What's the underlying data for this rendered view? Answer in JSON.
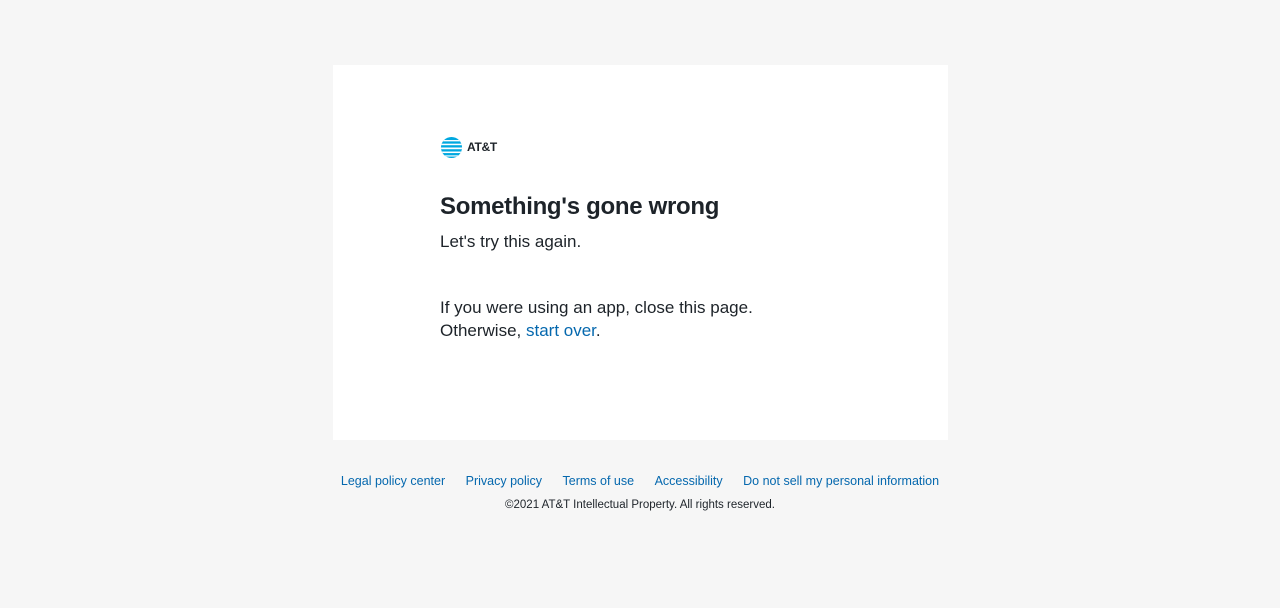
{
  "brand": {
    "logo_text": "AT&T",
    "logo_icon": "att-globe-icon",
    "logo_color": "#00a8e0"
  },
  "error": {
    "title": "Something's gone wrong",
    "subtitle": "Let's try this again.",
    "line1": "If you were using an app, close this page.",
    "line2_prefix": "Otherwise, ",
    "link_text": "start over",
    "line2_suffix": "."
  },
  "footer": {
    "links": {
      "legal": "Legal policy center",
      "privacy": "Privacy policy",
      "terms": "Terms of use",
      "accessibility": "Accessibility",
      "do_not_sell": "Do not sell my personal information"
    },
    "copyright": "©2021 AT&T Intellectual Property. All rights reserved."
  },
  "colors": {
    "background": "#f6f6f6",
    "card": "#ffffff",
    "text": "#1d2329",
    "link": "#0568ae"
  }
}
